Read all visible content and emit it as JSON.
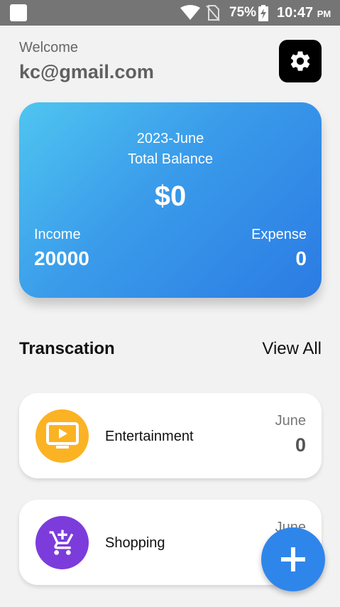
{
  "status_bar": {
    "battery_percent": "75%",
    "time": "10:47",
    "ampm": "PM"
  },
  "header": {
    "welcome": "Welcome",
    "email": "kc@gmail.com"
  },
  "balance_card": {
    "month": "2023-June",
    "total_label": "Total Balance",
    "total_value": "$0",
    "income_label": "Income",
    "income_value": "20000",
    "expense_label": "Expense",
    "expense_value": "0"
  },
  "transactions": {
    "title": "Transcation",
    "view_all": "View All",
    "items": [
      {
        "name": "Entertainment",
        "date": "June",
        "amount": "0",
        "icon": "tv-play-icon",
        "color": "#fbb324"
      },
      {
        "name": "Shopping",
        "date": "June",
        "amount": "",
        "icon": "cart-plus-icon",
        "color": "#7c3cdb"
      }
    ]
  },
  "colors": {
    "card_gradient_start": "#4fc5f0",
    "card_gradient_end": "#2b7be3",
    "fab": "#2f86ea"
  }
}
